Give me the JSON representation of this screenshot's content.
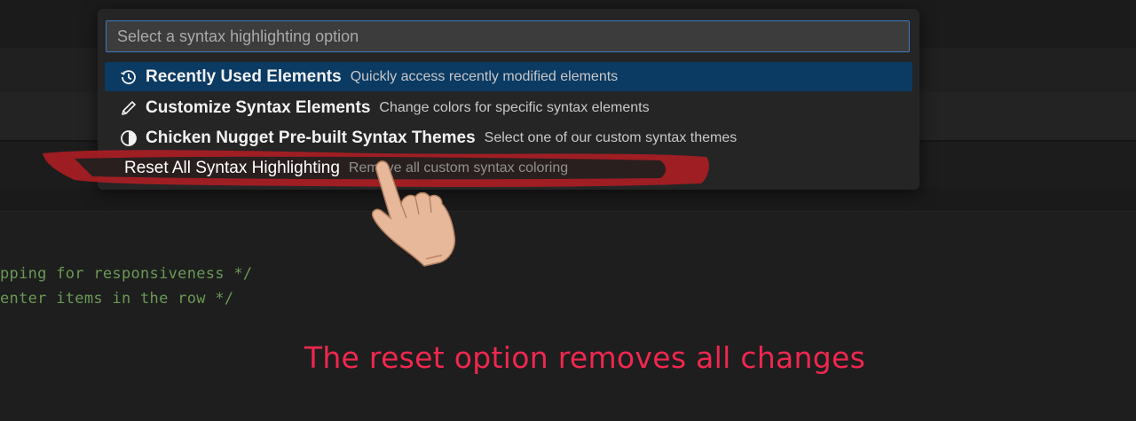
{
  "palette": {
    "placeholder": "Select a syntax highlighting option",
    "items": [
      {
        "icon": "history-icon",
        "label": "Recently Used Elements",
        "description": "Quickly access recently modified elements",
        "selected": true
      },
      {
        "icon": "pencil-icon",
        "label": "Customize Syntax Elements",
        "description": "Change colors for specific syntax elements",
        "selected": false
      },
      {
        "icon": "contrast-icon",
        "label": "Chicken Nugget Pre-built Syntax Themes",
        "description": "Select one of our custom syntax themes",
        "selected": false
      },
      {
        "icon": "",
        "label": "Reset All Syntax Highlighting",
        "description": "Remove all custom syntax coloring",
        "selected": false
      }
    ]
  },
  "editor": {
    "lines": [
      "pping for responsiveness */",
      "enter items in the row */"
    ]
  },
  "annotation": {
    "caption": "The reset option removes all changes",
    "highlight_color": "#b01e23",
    "caption_color": "#f0274f",
    "pointer": "hand-pointer-icon"
  }
}
